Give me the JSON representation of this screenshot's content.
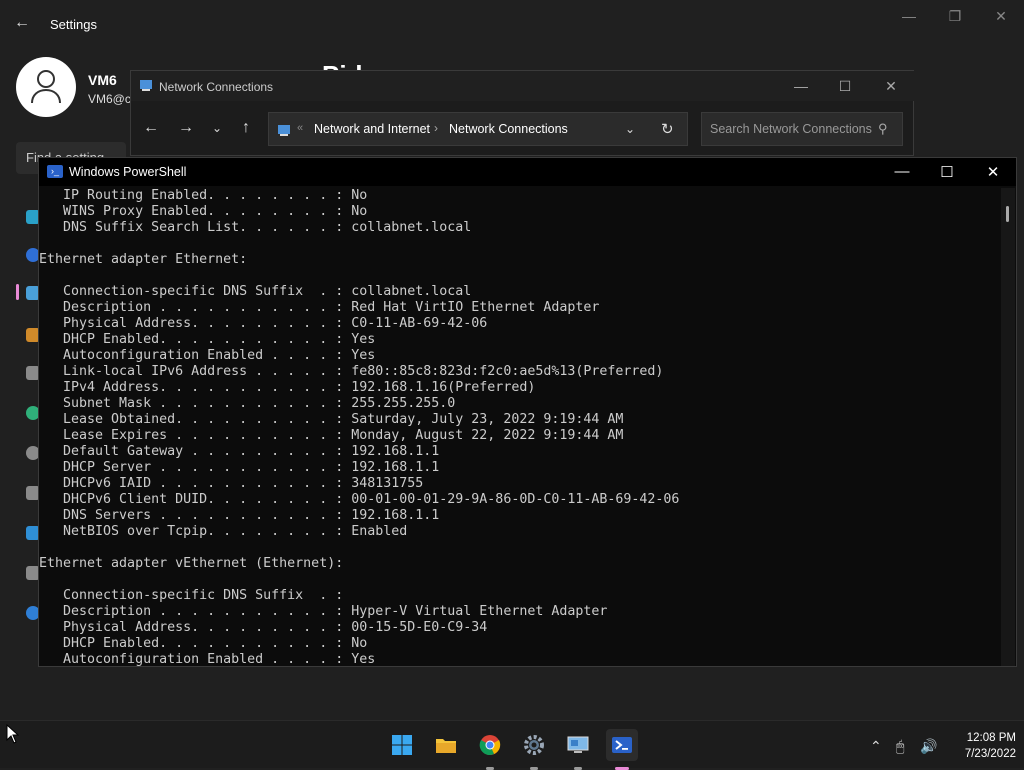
{
  "settings": {
    "title": "Settings",
    "user_name": "VM6",
    "user_email": "VM6@c",
    "find_placeholder": "Find a setting",
    "page_heading": "Pid"
  },
  "network_window": {
    "title": "Network Connections",
    "breadcrumb": [
      "Network and Internet",
      "Network Connections"
    ],
    "search_placeholder": "Search Network Connections"
  },
  "powershell": {
    "title": "Windows PowerShell",
    "lines": [
      "   IP Routing Enabled. . . . . . . . : No",
      "   WINS Proxy Enabled. . . . . . . . : No",
      "   DNS Suffix Search List. . . . . . : collabnet.local",
      "",
      "Ethernet adapter Ethernet:",
      "",
      "   Connection-specific DNS Suffix  . : collabnet.local",
      "   Description . . . . . . . . . . . : Red Hat VirtIO Ethernet Adapter",
      "   Physical Address. . . . . . . . . : C0-11-AB-69-42-06",
      "   DHCP Enabled. . . . . . . . . . . : Yes",
      "   Autoconfiguration Enabled . . . . : Yes",
      "   Link-local IPv6 Address . . . . . : fe80::85c8:823d:f2c0:ae5d%13(Preferred)",
      "   IPv4 Address. . . . . . . . . . . : 192.168.1.16(Preferred)",
      "   Subnet Mask . . . . . . . . . . . : 255.255.255.0",
      "   Lease Obtained. . . . . . . . . . : Saturday, July 23, 2022 9:19:44 AM",
      "   Lease Expires . . . . . . . . . . : Monday, August 22, 2022 9:19:44 AM",
      "   Default Gateway . . . . . . . . . : 192.168.1.1",
      "   DHCP Server . . . . . . . . . . . : 192.168.1.1",
      "   DHCPv6 IAID . . . . . . . . . . . : 348131755",
      "   DHCPv6 Client DUID. . . . . . . . : 00-01-00-01-29-9A-86-0D-C0-11-AB-69-42-06",
      "   DNS Servers . . . . . . . . . . . : 192.168.1.1",
      "   NetBIOS over Tcpip. . . . . . . . : Enabled",
      "",
      "Ethernet adapter vEthernet (Ethernet):",
      "",
      "   Connection-specific DNS Suffix  . :",
      "   Description . . . . . . . . . . . : Hyper-V Virtual Ethernet Adapter",
      "   Physical Address. . . . . . . . . : 00-15-5D-E0-C9-34",
      "   DHCP Enabled. . . . . . . . . . . : No",
      "   Autoconfiguration Enabled . . . . : Yes"
    ]
  },
  "taskbar": {
    "time": "12:08 PM",
    "date": "7/23/2022",
    "apps": [
      "start-icon",
      "file-explorer-icon",
      "chrome-icon",
      "settings-icon",
      "network-connections-icon",
      "powershell-icon"
    ]
  },
  "colors": {
    "accent_pink": "#e98ad6",
    "console_text": "#cccccc",
    "powershell_blue": "#2a62c9"
  }
}
